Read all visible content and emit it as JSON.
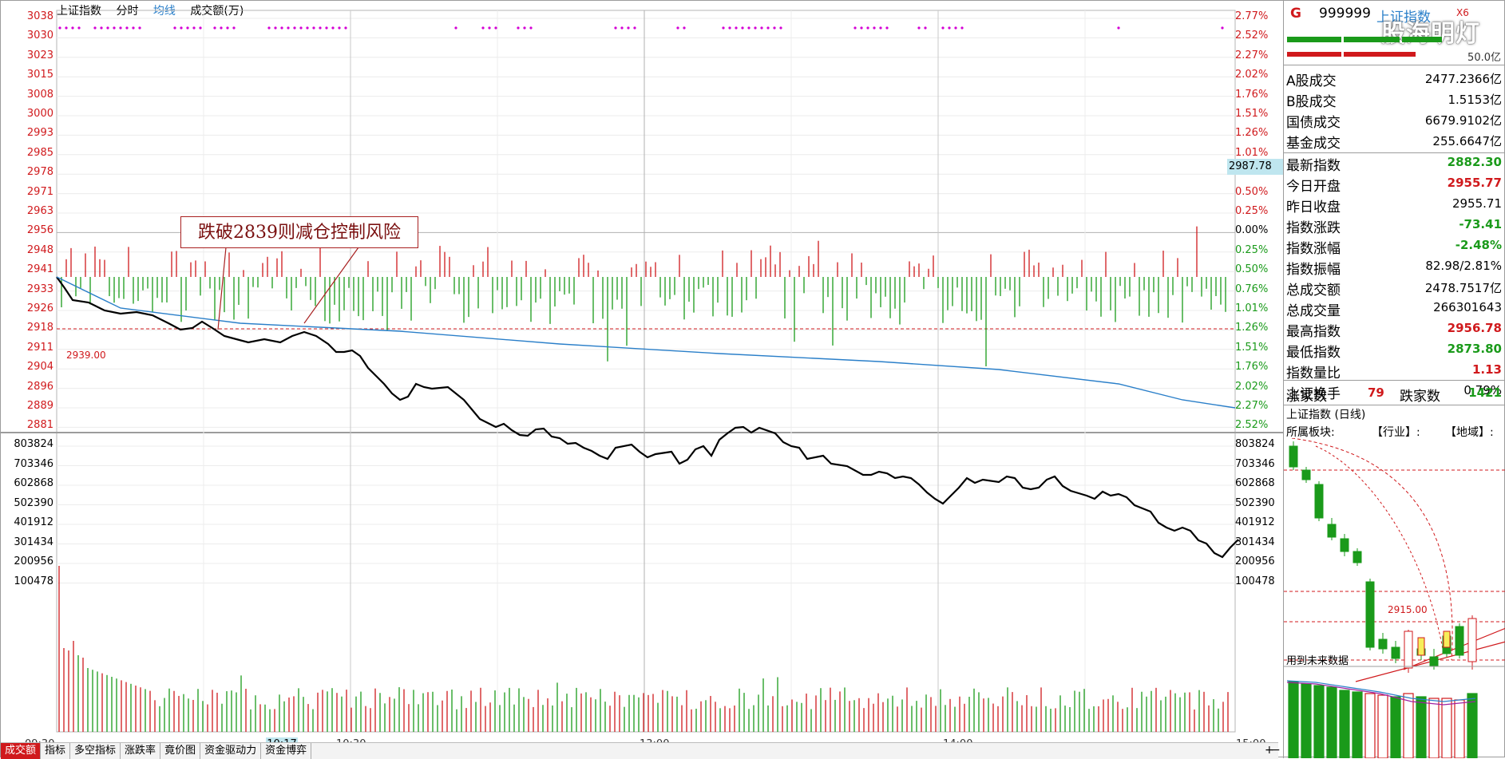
{
  "chart_title": {
    "name": "上证指数",
    "mode": "分时",
    "avg": "均线",
    "vol": "成交额(万)"
  },
  "price_axis": [
    "3038",
    "3030",
    "3023",
    "3015",
    "3008",
    "3000",
    "2993",
    "2985",
    "2978",
    "2971",
    "2963",
    "2956",
    "2948",
    "2941",
    "2933",
    "2926",
    "2918",
    "2911",
    "2904",
    "2896",
    "2889",
    "2881"
  ],
  "pct_axis": [
    {
      "t": "2.77%",
      "c": "#d0191c"
    },
    {
      "t": "2.52%",
      "c": "#d0191c"
    },
    {
      "t": "2.27%",
      "c": "#d0191c"
    },
    {
      "t": "2.02%",
      "c": "#d0191c"
    },
    {
      "t": "1.76%",
      "c": "#d0191c"
    },
    {
      "t": "1.51%",
      "c": "#d0191c"
    },
    {
      "t": "1.26%",
      "c": "#d0191c"
    },
    {
      "t": "1.01%",
      "c": "#d0191c"
    },
    {
      "t": "0.76%",
      "c": "#d0191c"
    },
    {
      "t": "0.50%",
      "c": "#d0191c"
    },
    {
      "t": "0.25%",
      "c": "#d0191c"
    },
    {
      "t": "0.00%",
      "c": "#000000"
    },
    {
      "t": "0.25%",
      "c": "#1a9a1a"
    },
    {
      "t": "0.50%",
      "c": "#1a9a1a"
    },
    {
      "t": "0.76%",
      "c": "#1a9a1a"
    },
    {
      "t": "1.01%",
      "c": "#1a9a1a"
    },
    {
      "t": "1.26%",
      "c": "#1a9a1a"
    },
    {
      "t": "1.51%",
      "c": "#1a9a1a"
    },
    {
      "t": "1.76%",
      "c": "#1a9a1a"
    },
    {
      "t": "2.02%",
      "c": "#1a9a1a"
    },
    {
      "t": "2.27%",
      "c": "#1a9a1a"
    },
    {
      "t": "2.52%",
      "c": "#1a9a1a"
    }
  ],
  "vol_axis": [
    "803824",
    "703346",
    "602868",
    "502390",
    "401912",
    "301434",
    "200956",
    "100478"
  ],
  "time_axis": [
    "09:30",
    "10:30",
    "13:00",
    "14:00",
    "15:00"
  ],
  "cursor_time": "10:17",
  "current_price_tag": "2987.78",
  "ref_line_label": "2939.00",
  "annotation": "跌破2839则减仓控制风险",
  "tabs": [
    "成交额",
    "指标",
    "多空指标",
    "涨跌率",
    "竟价图",
    "资金驱动力",
    "资金博弈"
  ],
  "plus": "+",
  "minus": "−",
  "panel": {
    "g": "G",
    "code": "999999",
    "name": "上证指数",
    "x": "X6",
    "watermark": "股海明灯",
    "bar_value": "50.0亿",
    "quotes": [
      {
        "k": "A股成交",
        "v": "2477.2366亿",
        "c": "#000000"
      },
      {
        "k": "B股成交",
        "v": "1.5153亿",
        "c": "#000000"
      },
      {
        "k": "国债成交",
        "v": "6679.9102亿",
        "c": "#000000"
      },
      {
        "k": "基金成交",
        "v": "255.6647亿",
        "c": "#000000"
      }
    ],
    "stats": [
      {
        "k": "最新指数",
        "v": "2882.30",
        "c": "#1a9a1a"
      },
      {
        "k": "今日开盘",
        "v": "2955.77",
        "c": "#d0191c"
      },
      {
        "k": "昨日收盘",
        "v": "2955.71",
        "c": "#000000"
      },
      {
        "k": "指数涨跌",
        "v": "-73.41",
        "c": "#1a9a1a"
      },
      {
        "k": "指数涨幅",
        "v": "-2.48%",
        "c": "#1a9a1a"
      },
      {
        "k": "指数振幅",
        "v": "82.98/2.81%",
        "c": "#000000"
      },
      {
        "k": "总成交额",
        "v": "2478.7517亿",
        "c": "#000000"
      },
      {
        "k": "总成交量",
        "v": "266301643",
        "c": "#000000"
      },
      {
        "k": "最高指数",
        "v": "2956.78",
        "c": "#d0191c"
      },
      {
        "k": "最低指数",
        "v": "2873.80",
        "c": "#1a9a1a"
      },
      {
        "k": "指数量比",
        "v": "1.13",
        "c": "#d0191c"
      },
      {
        "k": "上证换手",
        "v": "0.79%",
        "c": "#000000"
      }
    ],
    "breadth": {
      "up_label": "涨家数",
      "up": "79",
      "down_label": "跌家数",
      "down": "1421"
    },
    "daily_title": "上证指数 (日线)",
    "sectors": [
      "所属板块:",
      "【行业】:",
      "【地域】:"
    ],
    "daily_price_label": "2915.00",
    "future_label": "用到未来数据"
  },
  "colors": {
    "up": "#d0191c",
    "down": "#1a9a1a",
    "avg": "#2a7fc9",
    "price": "#000000",
    "magenta": "#d400d4"
  }
}
